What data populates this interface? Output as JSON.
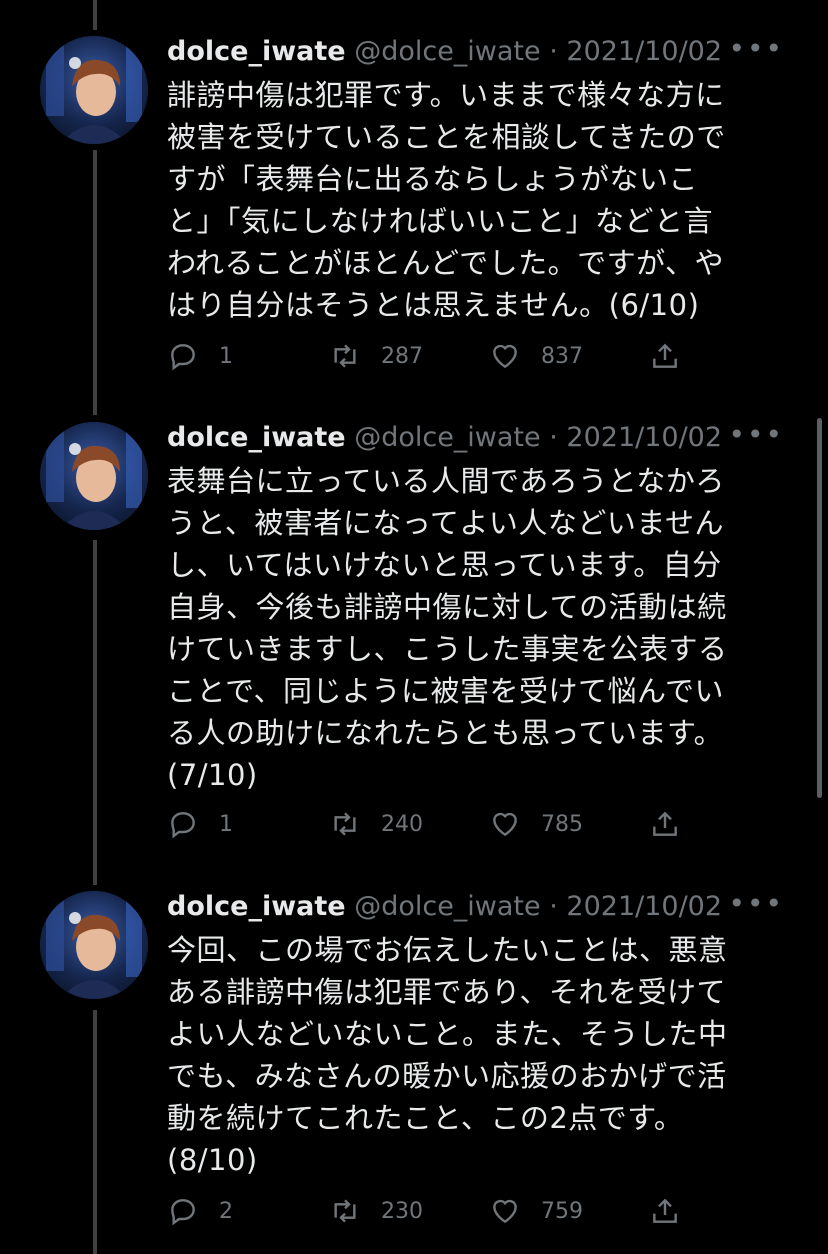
{
  "tweets": [
    {
      "name": "dolce_iwate",
      "handle": "@dolce_iwate",
      "sep": "·",
      "date": "2021/10/02",
      "text": "誹謗中傷は犯罪です。いままで様々な方に\n被害を受けていることを相談してきたので\nすが「表舞台に出るならしょうがないこ\nと」「気にしなければいいこと」などと言\nわれることがほとんどでした。ですが、や\nはり自分はそうとは思えません。(6/10)",
      "replies": "1",
      "retweets": "287",
      "likes": "837"
    },
    {
      "name": "dolce_iwate",
      "handle": "@dolce_iwate",
      "sep": "·",
      "date": "2021/10/02",
      "text": "表舞台に立っている人間であろうとなかろ\nうと、被害者になってよい人などいません\nし、いてはいけないと思っています。自分\n自身、今後も誹謗中傷に対しての活動は続\nけていきますし、こうした事実を公表する\nことで、同じように被害を受けて悩んでい\nる人の助けになれたらとも思っています。\n(7/10)",
      "replies": "1",
      "retweets": "240",
      "likes": "785"
    },
    {
      "name": "dolce_iwate",
      "handle": "@dolce_iwate",
      "sep": "·",
      "date": "2021/10/02",
      "text": "今回、この場でお伝えしたいことは、悪意\nある誹謗中傷は犯罪であり、それを受けて\nよい人などいないこと。また、そうした中\nでも、みなさんの暖かい応援のおかげで活\n動を続けてこれたこと、この2点です。\n(8/10)",
      "replies": "2",
      "retweets": "230",
      "likes": "759"
    }
  ],
  "icons": {
    "more": "more-icon",
    "reply": "reply-icon",
    "retweet": "retweet-icon",
    "like": "heart-icon",
    "share": "share-icon"
  },
  "more_label": "•••"
}
